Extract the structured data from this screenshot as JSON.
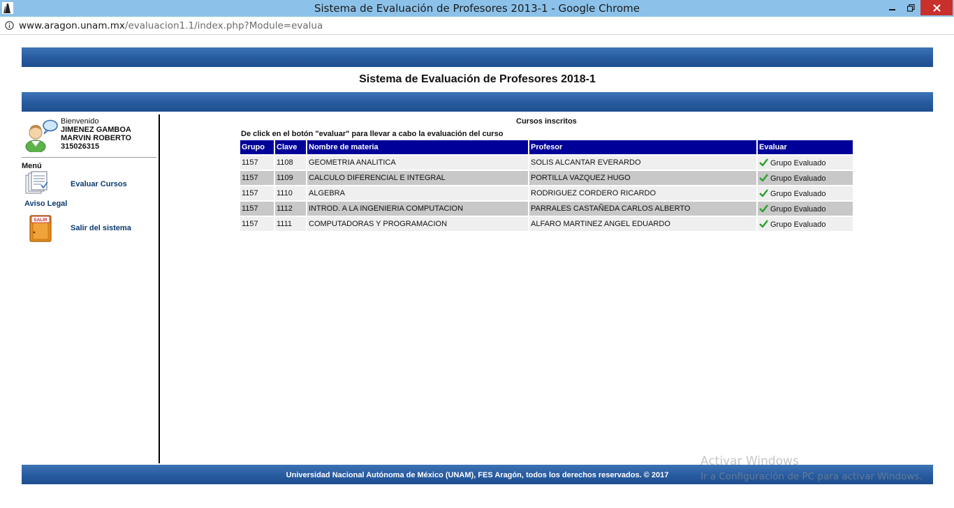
{
  "window": {
    "title": "Sistema de Evaluación de Profesores 2013-1 - Google Chrome",
    "minimize_icon": "minimize-icon",
    "maximize_icon": "restore-icon",
    "close_icon": "close-icon"
  },
  "address": {
    "host": "www.aragon.unam.mx",
    "path": "/evaluacion1.1/index.php?Module=evalua"
  },
  "header": {
    "title": "Sistema de Evaluación de Profesores 2018-1"
  },
  "sidebar": {
    "welcome": "Bienvenido",
    "name_line1": "JIMENEZ GAMBOA",
    "name_line2": "MARVIN ROBERTO",
    "account": "315026315",
    "menu_label": "Menú",
    "evaluar_label": "Evaluar Cursos",
    "aviso_label": "Aviso Legal",
    "salir_label": "Salir del sistema",
    "salir_sign": "SALIR"
  },
  "main": {
    "section_title": "Cursos inscritos",
    "instruction": "De click en el botón \"evaluar\" para llevar a cabo la evaluación del curso",
    "columns": [
      "Grupo",
      "Clave",
      "Nombre de materia",
      "Profesor",
      "Evaluar"
    ],
    "rows": [
      {
        "grupo": "1157",
        "clave": "1108",
        "materia": "GEOMETRIA ANALITICA",
        "profesor": "SOLIS ALCANTAR EVERARDO",
        "evaluar": "Grupo Evaluado"
      },
      {
        "grupo": "1157",
        "clave": "1109",
        "materia": "CALCULO DIFERENCIAL E INTEGRAL",
        "profesor": "PORTILLA VAZQUEZ HUGO",
        "evaluar": "Grupo Evaluado"
      },
      {
        "grupo": "1157",
        "clave": "1110",
        "materia": "ALGEBRA",
        "profesor": "RODRIGUEZ CORDERO RICARDO",
        "evaluar": "Grupo Evaluado"
      },
      {
        "grupo": "1157",
        "clave": "1112",
        "materia": "INTROD. A LA INGENIERIA COMPUTACION",
        "profesor": "PARRALES CASTAÑEDA CARLOS ALBERTO",
        "evaluar": "Grupo Evaluado"
      },
      {
        "grupo": "1157",
        "clave": "1111",
        "materia": "COMPUTADORAS Y PROGRAMACION",
        "profesor": "ALFARO MARTINEZ ANGEL EDUARDO",
        "evaluar": "Grupo Evaluado"
      }
    ]
  },
  "footer": {
    "text": "Universidad Nacional Autónoma de México (UNAM), FES Aragón, todos los derechos reservados. © 2017"
  },
  "watermark": {
    "line1": "Activar Windows",
    "line2": "Ir a Configuración de PC para activar Windows."
  },
  "colors": {
    "band": "#275b9f",
    "table_header": "#000099",
    "row_light": "#efefef",
    "row_dark": "#c8c8c8",
    "check": "#2e9e2e"
  }
}
